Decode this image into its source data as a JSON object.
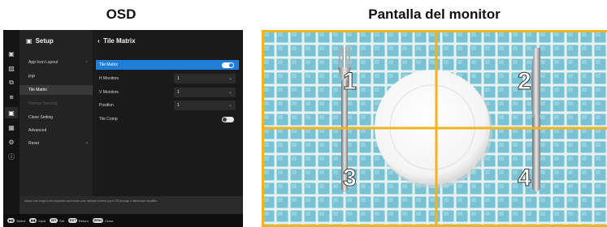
{
  "headings": {
    "osd": "OSD",
    "monitor": "Pantalla del monitor"
  },
  "osd": {
    "menu_title": "Setup",
    "menu_items": [
      {
        "label": "App Icon Layout",
        "chevron": true
      },
      {
        "label": "PIP",
        "chevron": false
      },
      {
        "label": "Tile Matrix",
        "chevron": false,
        "selected": true
      },
      {
        "label": "Human Sensing",
        "chevron": false,
        "disabled": true
      },
      {
        "label": "Clone Setting",
        "chevron": false
      },
      {
        "label": "Advanced",
        "chevron": false
      },
      {
        "label": "Reset",
        "chevron": true
      }
    ],
    "detail_title": "Tile Matrix",
    "settings": {
      "tile_matrix": {
        "label": "Tile Matrix",
        "on": true
      },
      "h_monitors": {
        "label": "H Monitors",
        "value": "1"
      },
      "v_monitors": {
        "label": "V Monitors",
        "value": "1"
      },
      "position": {
        "label": "Position",
        "value": "1"
      },
      "tile_comp": {
        "label": "Tile Comp",
        "on": false
      }
    },
    "info_text": "Allows one image to be expanded and shown over multiple screens (up to 25) through a distribution amplifier.",
    "hints": [
      {
        "key": "◉◉",
        "label": "Select"
      },
      {
        "key": "◉◉",
        "label": "Input"
      },
      {
        "key": "SET",
        "label": "Set"
      },
      {
        "key": "EXIT",
        "label": "Return"
      },
      {
        "key": "MENU",
        "label": "Close"
      }
    ]
  },
  "monitor": {
    "tile_labels": [
      "1",
      "2",
      "3",
      "4"
    ],
    "colors": {
      "divider": "#f2b41c",
      "tile": "#7ec6d6",
      "grout": "#e8f2f2",
      "plate": "#ffffff"
    }
  }
}
